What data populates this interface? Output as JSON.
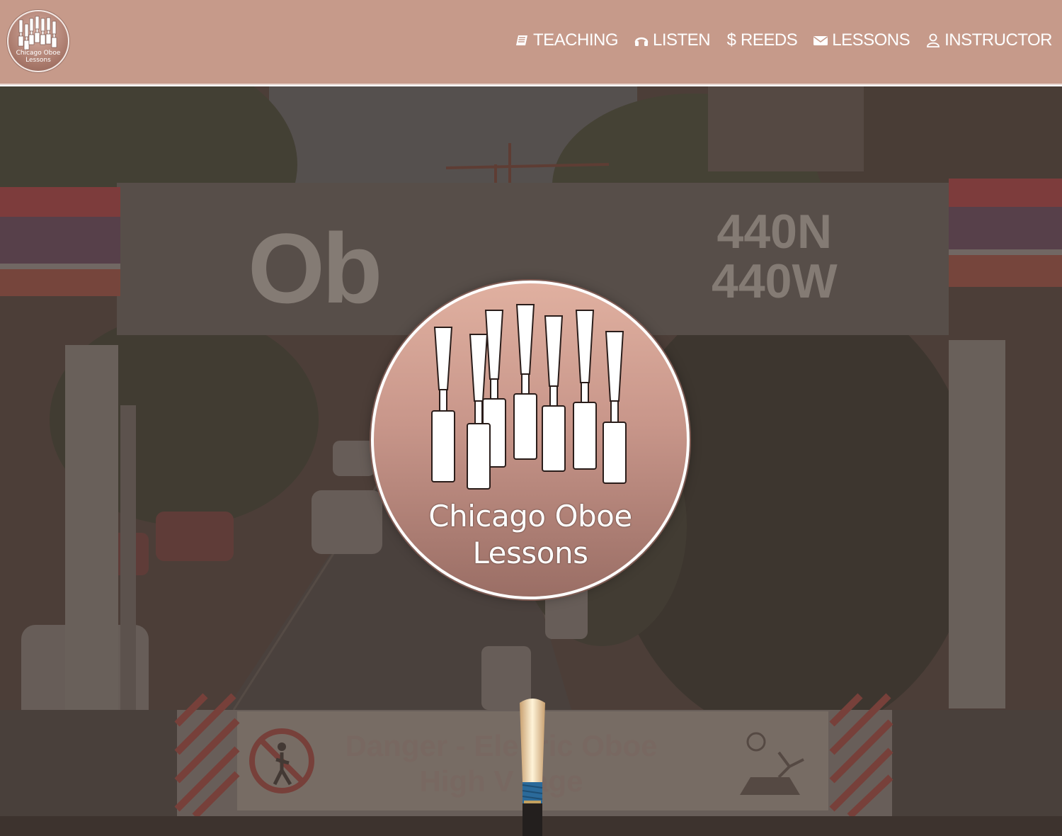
{
  "brand": {
    "logo_line1": "Chicago Oboe",
    "logo_line2": "Lessons"
  },
  "nav": {
    "items": [
      {
        "icon": "book-icon",
        "label": "TEACHING"
      },
      {
        "icon": "headphones-icon",
        "label": "LISTEN"
      },
      {
        "icon": "dollar-icon",
        "glyph": "$",
        "label": "REEDS"
      },
      {
        "icon": "envelope-icon",
        "label": "LESSONS"
      },
      {
        "icon": "user-icon",
        "label": "INSTRUCTOR"
      }
    ]
  },
  "hero": {
    "sign_big": "Ob",
    "sign_address_line1": "440N",
    "sign_address_line2": "440W",
    "danger_line1": "Danger -  Ele  tric Oboe",
    "danger_line2": "High V  tage",
    "logo_title_line1": "Chicago Oboe",
    "logo_title_line2": "Lessons"
  },
  "colors": {
    "navbar": "#c69a8a",
    "nav_text": "#ffffff",
    "logo_top": "#e0b0a0",
    "logo_bottom": "#9a6e65",
    "hero_overlay": "#3c2c26"
  }
}
